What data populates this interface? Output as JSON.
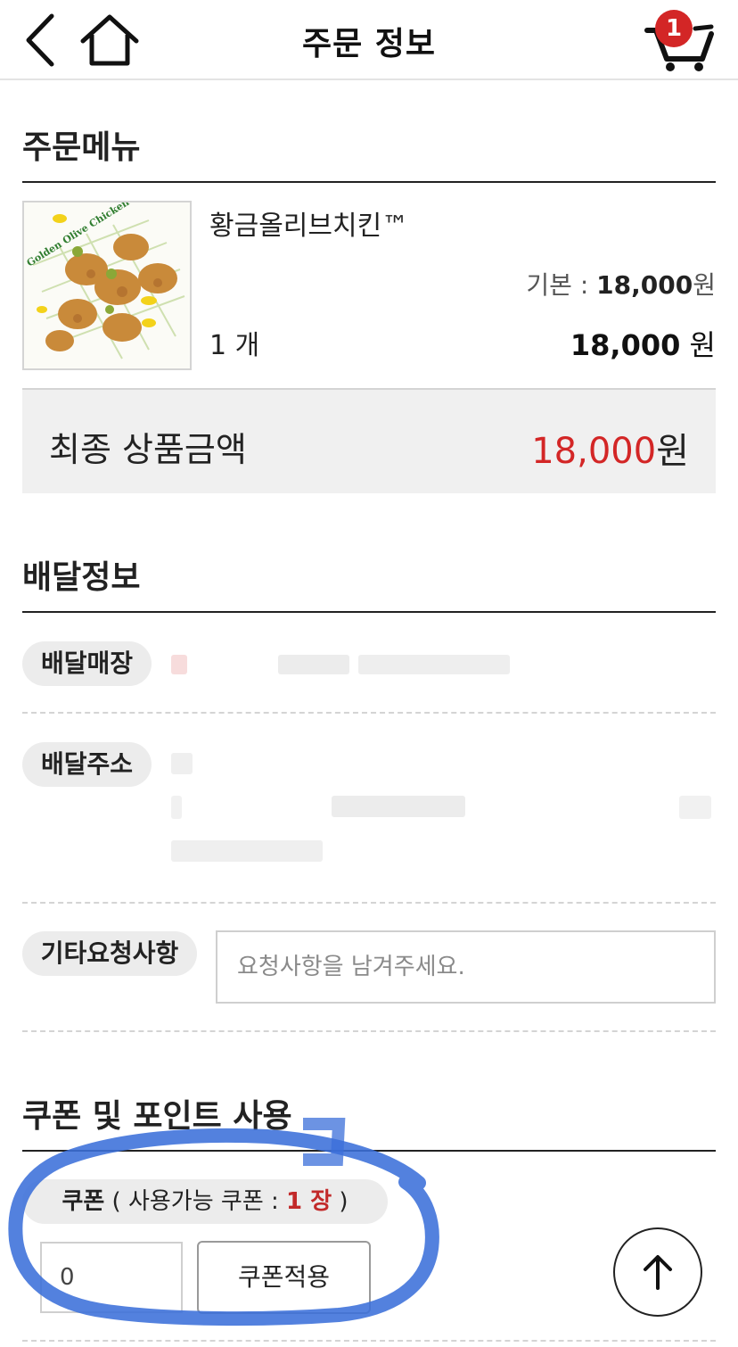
{
  "header": {
    "title": "주문 정보",
    "cart_count": "1"
  },
  "order_menu": {
    "section_title": "주문메뉴",
    "item": {
      "name": "황금올리브치킨™",
      "image_caption": "Golden Olive Chicken",
      "base_label": "기본 : ",
      "base_price": "18,000",
      "base_unit": "원",
      "quantity": "1 개",
      "line_total": "18,000",
      "line_total_unit": " 원"
    },
    "final_label": "최종 상품금액",
    "final_amount": "18,000",
    "final_unit": "원"
  },
  "delivery": {
    "section_title": "배달정보",
    "store_label": "배달매장",
    "address_label": "배달주소",
    "request_label": "기타요청사항",
    "request_placeholder": "요청사항을 남겨주세요."
  },
  "coupon_points": {
    "section_title": "쿠폰 및 포인트 사용",
    "coupon_label": "쿠폰",
    "coupon_available_prefix": " ( 사용가능 쿠폰 : ",
    "coupon_count": "1 장",
    "coupon_available_suffix": " )",
    "coupon_input_value": "0",
    "apply_button": "쿠폰적용"
  },
  "colors": {
    "accent_red": "#d32626",
    "annotation_blue": "#3b6fd9"
  },
  "icons": [
    "back-arrow-icon",
    "home-icon",
    "cart-icon",
    "arrow-up-icon"
  ]
}
